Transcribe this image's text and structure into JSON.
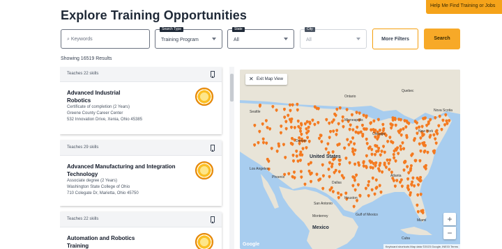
{
  "help_tab": "Help Me Find Training or Jobs",
  "page_title": "Explore Training Opportunities",
  "filters": {
    "keywords_placeholder": "Keywords",
    "search_type_label": "Search Type",
    "search_type_value": "Training Program",
    "state_label": "State",
    "state_value": "All",
    "city_label": "City",
    "city_value": "All",
    "more_filters": "More Filters",
    "search": "Search"
  },
  "results_count": "Showing 16519 Results",
  "results": [
    {
      "skills": "Teaches 22 skills",
      "title_lines": [
        "Advanced Industrial",
        "Robotics"
      ],
      "credential": "Certificate of completion (2 Years)",
      "provider": "Greene County Career Center",
      "address": "532 Innovation Drive, Xenia, Ohio 45385"
    },
    {
      "skills": "Teaches 29 skills",
      "title_lines": [
        "Advanced Manufacturing and Integration",
        "Technology"
      ],
      "credential": "Associate degree (2 Years)",
      "provider": "Washington State College of Ohio",
      "address": "710 Colegate Dr, Marietta, Ohio 45750"
    },
    {
      "skills": "Teaches 22 skills",
      "title_lines": [
        "Automation and Robotics",
        "Training"
      ],
      "credential": "",
      "provider": "",
      "address": ""
    }
  ],
  "map": {
    "exit_label": "Exit Map View",
    "labels": {
      "us": "United States",
      "mexico": "Mexico",
      "cuba": "Cuba",
      "gulf": "Gulf of Mexico",
      "ontario": "Ontario",
      "quebec": "Quebec",
      "nova_scotia": "Nova Scotia",
      "new_york": "New York",
      "chicago": "Chicago",
      "dallas": "Dallas",
      "houston": "Houston",
      "atlanta": "Atlanta",
      "miami": "Miami",
      "san_antonio": "San Antonio",
      "monterrey": "Monterrey",
      "los_angeles": "Los Angeles",
      "phoenix": "Phoenix",
      "denver": "Denver",
      "seattle": "Seattle",
      "minneapolis": "Minneapolis"
    },
    "zoom_in": "+",
    "zoom_out": "−",
    "google": "Google",
    "attribution": "Keyboard shortcuts  Map data ©2023 Google, INEGI  Terms",
    "marker_color": "#f47a20",
    "land_color": "#e8e4d8",
    "water_color": "#a8cdef"
  },
  "colors": {
    "accent": "#f7a928",
    "help_tab": "#f5a31a"
  }
}
